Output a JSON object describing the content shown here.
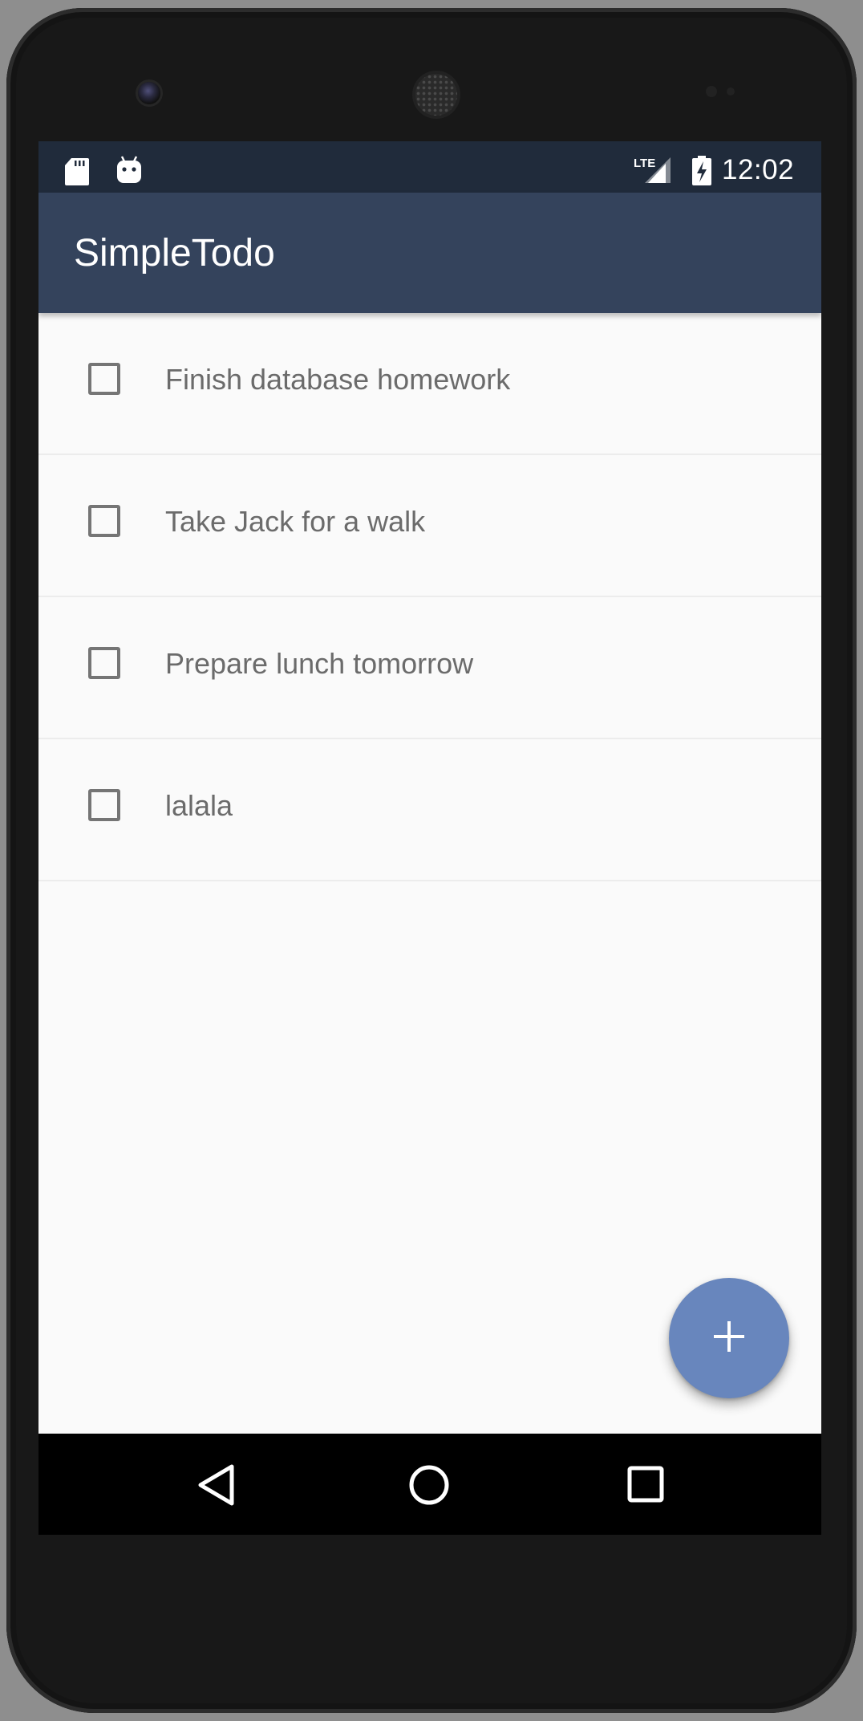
{
  "status_bar": {
    "time": "12:02",
    "network_label": "LTE",
    "icons": [
      "sd-card-icon",
      "android-debug-icon",
      "lte-signal-icon",
      "battery-charging-icon"
    ]
  },
  "app_bar": {
    "title": "SimpleTodo"
  },
  "todos": [
    {
      "label": "Finish database homework",
      "checked": false
    },
    {
      "label": "Take Jack for a walk",
      "checked": false
    },
    {
      "label": "Prepare lunch tomorrow",
      "checked": false
    },
    {
      "label": "lalala",
      "checked": false
    }
  ],
  "fab": {
    "icon": "plus-icon"
  },
  "nav_bar": {
    "icons": [
      "back-icon",
      "home-icon",
      "recents-icon"
    ]
  },
  "colors": {
    "status_bar": "#202b3b",
    "app_bar": "#34435c",
    "fab": "#6886bd",
    "background": "#fafafa"
  }
}
